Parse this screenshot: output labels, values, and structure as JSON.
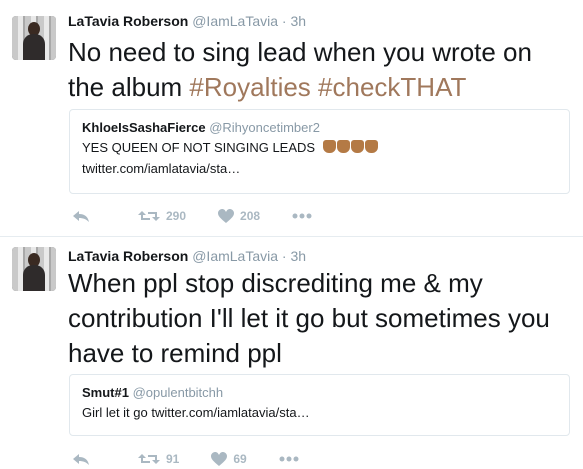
{
  "tweets": [
    {
      "name": "LaTavia Roberson",
      "handle": "@IamLaTavia",
      "sep": "·",
      "time": "3h",
      "text_plain": "No need to sing lead when you wrote on the album ",
      "hashtag1": "#Royalties",
      "hashtag2": "#checkTHAT",
      "quote": {
        "name": "KhloeIsSashaFierce",
        "handle": "@Rihyoncetimber2",
        "line1": "YES QUEEN OF NOT SINGING LEADS",
        "line2": "twitter.com/iamlatavia/sta…"
      },
      "retweets": "290",
      "likes": "208"
    },
    {
      "name": "LaTavia Roberson",
      "handle": "@IamLaTavia",
      "sep": "·",
      "time": "3h",
      "text": "When ppl stop discrediting me & my contribution I'll let it go but sometimes you have to remind ppl",
      "quote": {
        "name": "Smut#1",
        "handle": "@opulentbitchh",
        "line1": "Girl let it go twitter.com/iamlatavia/sta…"
      },
      "retweets": "91",
      "likes": "69"
    }
  ],
  "icons": {
    "reply": "reply-icon",
    "retweet": "retweet-icon",
    "like": "heart-icon",
    "more": "more-icon",
    "emoji": "raised-hands-emoji"
  },
  "colors": {
    "hashtag": "#a0785c",
    "muted": "#8899a6",
    "action": "#aab8c2"
  }
}
